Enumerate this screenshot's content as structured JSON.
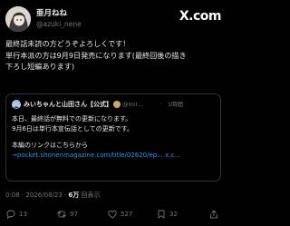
{
  "brand": {
    "label": "X.com"
  },
  "author": {
    "name": "亜月ねね",
    "handle": "@azuki_nene"
  },
  "tweet": {
    "lines": [
      "最終話未読の方どうぞよろしくです！",
      "単行本派の方は9月9日発売になります(最終回後の描き",
      "下ろし短編あります)"
    ]
  },
  "quote": {
    "name": "みいちゃんと山田さん【公式】",
    "handle": "@mii...",
    "separator": "·",
    "time": "1時間",
    "lines": [
      "本日、最終話が無料での更新になります。",
      "9月6日は単行本宣伝話としての更新です。"
    ],
    "link_intro": "本編のリンクはこちらから",
    "link": "→pocket.shonenmagazine.com/title/02620/ep... x.c..."
  },
  "meta": {
    "time": "0:08 · 2026/08/23 · ",
    "views": "6万",
    "views_suffix": " 回表示"
  },
  "actions": {
    "replies": "13",
    "retweets": "97",
    "likes": "527",
    "bookmarks": "32"
  },
  "colors": {
    "background": "#000000",
    "text": "#e7e9ea",
    "muted": "#71767b",
    "link": "#1d9bf0",
    "border": "#2f3336"
  }
}
